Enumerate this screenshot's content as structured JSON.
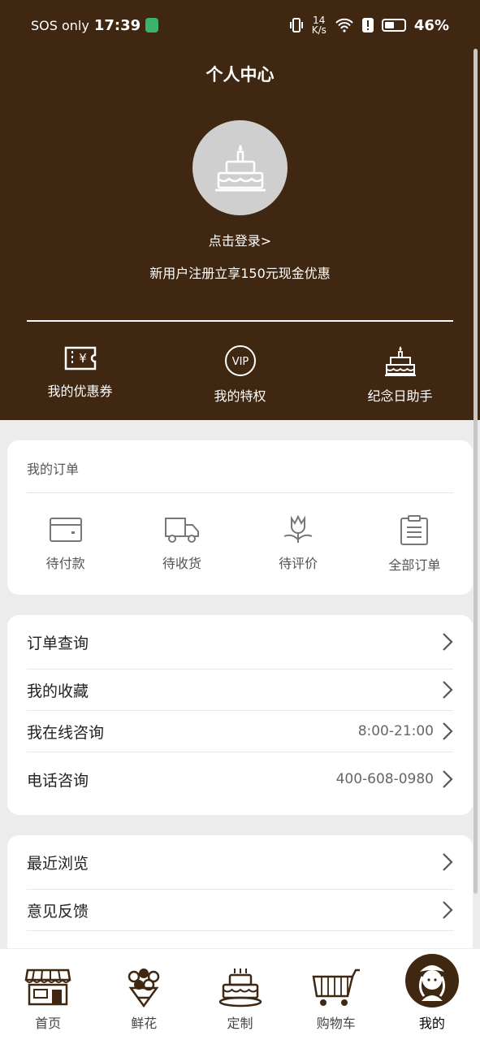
{
  "status": {
    "carrier": "SOS only",
    "time": "17:39",
    "speed_top": "14",
    "speed_bottom": "K/s",
    "battery": "46%"
  },
  "header": {
    "title": "个人中心",
    "login": "点击登录>",
    "promo": "新用户注册立享150元现金优惠"
  },
  "quick": {
    "coupons": "我的优惠券",
    "privileges": "我的特权",
    "anniversary": "纪念日助手",
    "vip_text": "VIP",
    "yen": "¥"
  },
  "orders": {
    "title": "我的订单",
    "items": [
      "待付款",
      "待收货",
      "待评价",
      "全部订单"
    ]
  },
  "menu": {
    "order_query": "订单查询",
    "favorites": "我的收藏",
    "online": "我在线咨询",
    "online_hours": "8:00-21:00",
    "phone": "电话咨询",
    "phone_number": "400-608-0980",
    "recent": "最近浏览",
    "feedback": "意见反馈"
  },
  "tabs": [
    "首页",
    "鲜花",
    "定制",
    "购物车",
    "我的"
  ],
  "colors": {
    "brand": "#3f2711",
    "background": "#ececec"
  }
}
